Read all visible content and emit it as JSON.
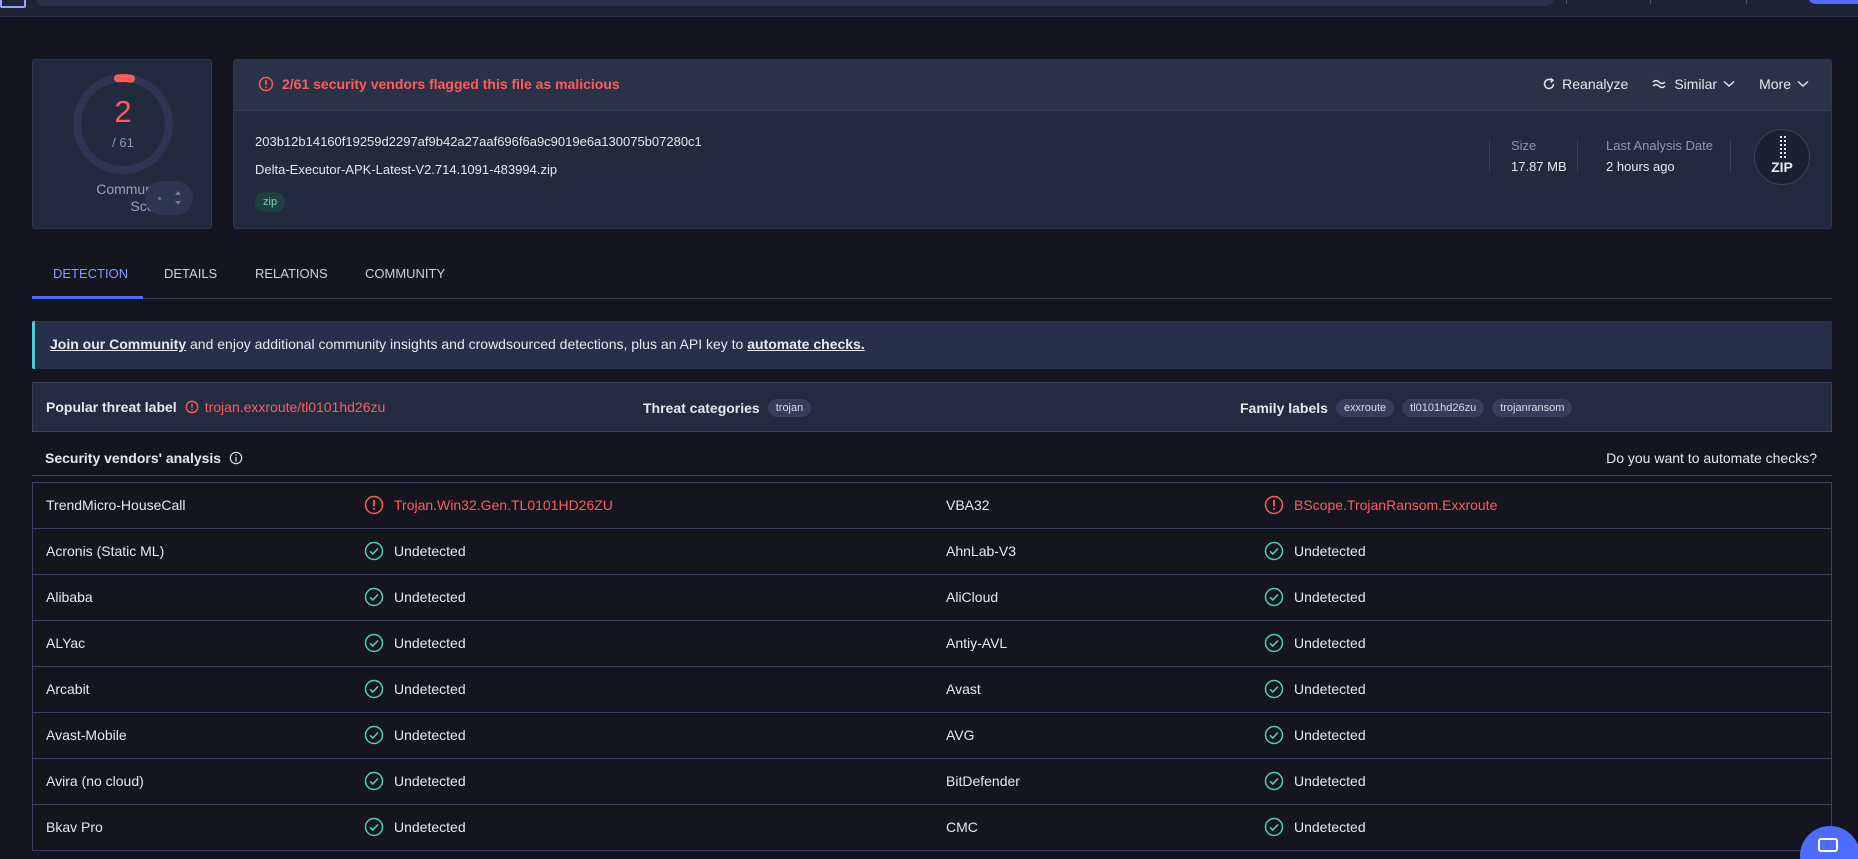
{
  "score": {
    "detected": "2",
    "total": "/ 61",
    "community_label_1": "Community",
    "community_label_2": "Score"
  },
  "summary": {
    "flag_text": "2/61 security vendors flagged this file as malicious",
    "actions": {
      "reanalyze": "Reanalyze",
      "similar": "Similar",
      "more": "More"
    },
    "hash": "203b12b14160f19259d2297af9b42a27aaf696f6a9c9019e6a130075b07280c1",
    "filename": "Delta-Executor-APK-Latest-V2.714.1091-483994.zip",
    "tag": "zip",
    "size_label": "Size",
    "size_value": "17.87 MB",
    "date_label": "Last Analysis Date",
    "date_value": "2 hours ago",
    "badge": "ZIP"
  },
  "tabs": [
    "DETECTION",
    "DETAILS",
    "RELATIONS",
    "COMMUNITY"
  ],
  "banner": {
    "link1": "Join our Community",
    "middle": " and enjoy additional community insights and crowdsourced detections, plus an API key to ",
    "link2": "automate checks."
  },
  "threat": {
    "popular_label": "Popular threat label",
    "popular_value": "trojan.exxroute/tl0101hd26zu",
    "categories_label": "Threat categories",
    "categories": [
      "trojan"
    ],
    "family_label": "Family labels",
    "families": [
      "exxroute",
      "tl0101hd26zu",
      "trojanransom"
    ]
  },
  "vendors": {
    "title": "Security vendors' analysis",
    "cta": "Do you want to automate checks?",
    "rows": [
      {
        "v1": "TrendMicro-HouseCall",
        "r1": "Trojan.Win32.Gen.TL0101HD26ZU",
        "s1": "bad",
        "v2": "VBA32",
        "r2": "BScope.TrojanRansom.Exxroute",
        "s2": "bad"
      },
      {
        "v1": "Acronis (Static ML)",
        "r1": "Undetected",
        "s1": "ok",
        "v2": "AhnLab-V3",
        "r2": "Undetected",
        "s2": "ok"
      },
      {
        "v1": "Alibaba",
        "r1": "Undetected",
        "s1": "ok",
        "v2": "AliCloud",
        "r2": "Undetected",
        "s2": "ok"
      },
      {
        "v1": "ALYac",
        "r1": "Undetected",
        "s1": "ok",
        "v2": "Antiy-AVL",
        "r2": "Undetected",
        "s2": "ok"
      },
      {
        "v1": "Arcabit",
        "r1": "Undetected",
        "s1": "ok",
        "v2": "Avast",
        "r2": "Undetected",
        "s2": "ok"
      },
      {
        "v1": "Avast-Mobile",
        "r1": "Undetected",
        "s1": "ok",
        "v2": "AVG",
        "r2": "Undetected",
        "s2": "ok"
      },
      {
        "v1": "Avira (no cloud)",
        "r1": "Undetected",
        "s1": "ok",
        "v2": "BitDefender",
        "r2": "Undetected",
        "s2": "ok"
      },
      {
        "v1": "Bkav Pro",
        "r1": "Undetected",
        "s1": "ok",
        "v2": "CMC",
        "r2": "Undetected",
        "s2": "ok"
      }
    ]
  },
  "colors": {
    "malicious": "#ff5b5b",
    "clean": "#4fd1b0",
    "accent": "#4d6bfe"
  }
}
